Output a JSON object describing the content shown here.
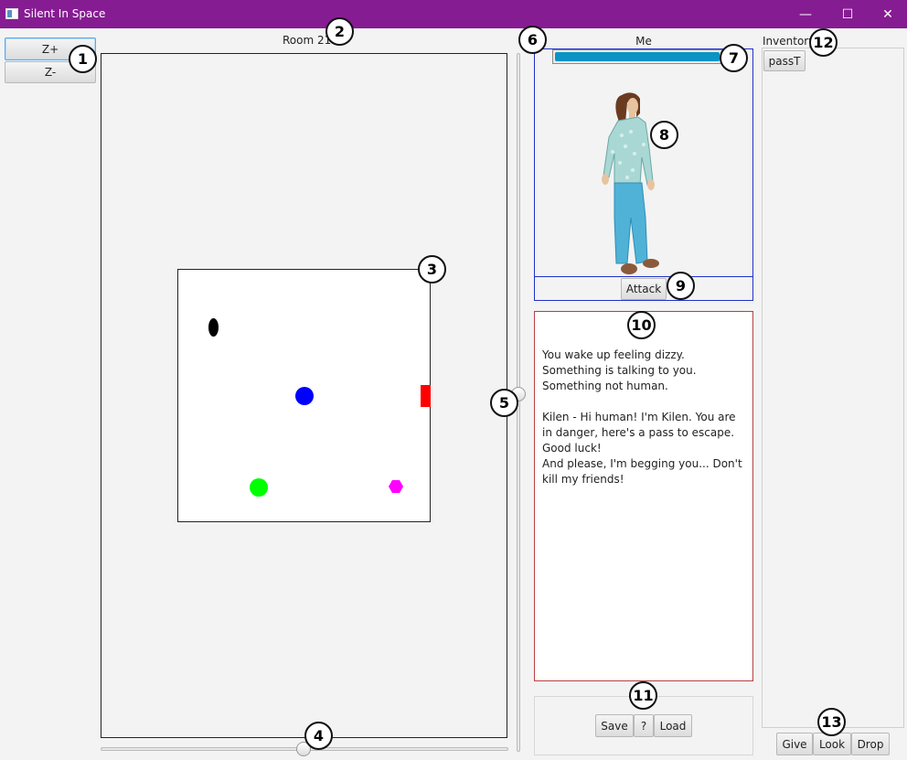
{
  "window": {
    "title": "Silent In Space",
    "controls": [
      "—",
      "☐",
      "✕"
    ]
  },
  "zoom": {
    "zoom_in_label": "Z+",
    "zoom_out_label": "Z-"
  },
  "map": {
    "room_label": "Room 21",
    "entities": [
      {
        "name": "black-oval-entity",
        "shape": "oval",
        "color": "#000000"
      },
      {
        "name": "blue-circle-player",
        "shape": "circle",
        "color": "#0000ff"
      },
      {
        "name": "red-door-exit",
        "shape": "rect",
        "color": "#ff0000"
      },
      {
        "name": "green-circle-entity",
        "shape": "circle",
        "color": "#00ff00"
      },
      {
        "name": "magenta-hexagon-item",
        "shape": "hexagon",
        "color": "#ff00ff"
      }
    ]
  },
  "character": {
    "name_label": "Me",
    "health_fraction": 1.0,
    "health_color": "#0a93c4",
    "attack_label": "Attack"
  },
  "message": {
    "text": "You wake up feeling dizzy. Something is talking to you. Something not human.\n\nKilen - Hi human! I'm Kilen. You are in danger, here's a pass to escape. Good luck!\nAnd please, I'm begging you... Don't kill my friends!"
  },
  "save_panel": {
    "save_label": "Save",
    "help_label": "?",
    "load_label": "Load"
  },
  "inventory": {
    "label": "Inventory",
    "items": [
      "passT"
    ],
    "give_label": "Give",
    "look_label": "Look",
    "drop_label": "Drop"
  },
  "callouts": [
    "1",
    "2",
    "3",
    "4",
    "5",
    "6",
    "7",
    "8",
    "9",
    "10",
    "11",
    "12",
    "13"
  ],
  "colors": {
    "titlebar": "#861c92",
    "panel_border_blue": "#2030c8",
    "panel_border_red": "#b74040"
  }
}
